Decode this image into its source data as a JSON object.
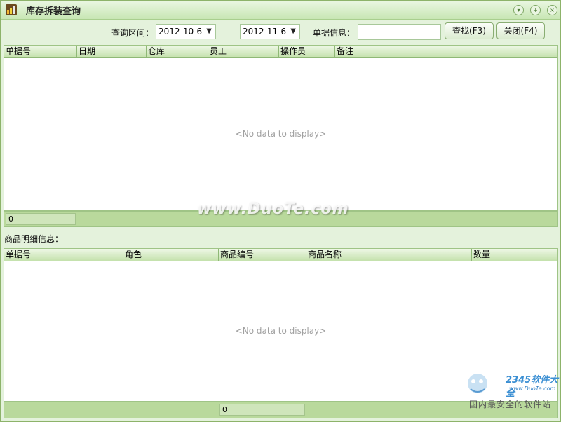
{
  "window": {
    "title": "库存拆装查询"
  },
  "toolbar": {
    "date_range_label": "查询区间：",
    "start_date": "2012-10-6",
    "separator": "--",
    "end_date": "2012-11-6",
    "doc_info_label": "单据信息：",
    "doc_info_value": "",
    "search_button": "查找(F3)",
    "close_button": "关闭(F4)"
  },
  "main_grid": {
    "columns": [
      "单据号",
      "日期",
      "仓库",
      "员工",
      "操作员",
      "备注"
    ],
    "empty_text": "<No data to display>",
    "count": "0"
  },
  "detail_section": {
    "label": "商品明细信息："
  },
  "detail_grid": {
    "columns": [
      "单据号",
      "角色",
      "商品编号",
      "商品名称",
      "数量"
    ],
    "empty_text": "<No data to display>",
    "count": "0"
  },
  "watermark": {
    "text": "www.DuoTe.com"
  },
  "brand": {
    "name": "2345软件大全",
    "site": "www.DuoTe.com",
    "slogan": "国内最安全的软件站"
  },
  "colors": {
    "accent": "#c4e1ac",
    "panel": "#e4f2dc",
    "footer": "#b9d99c",
    "border": "#8fb876"
  }
}
